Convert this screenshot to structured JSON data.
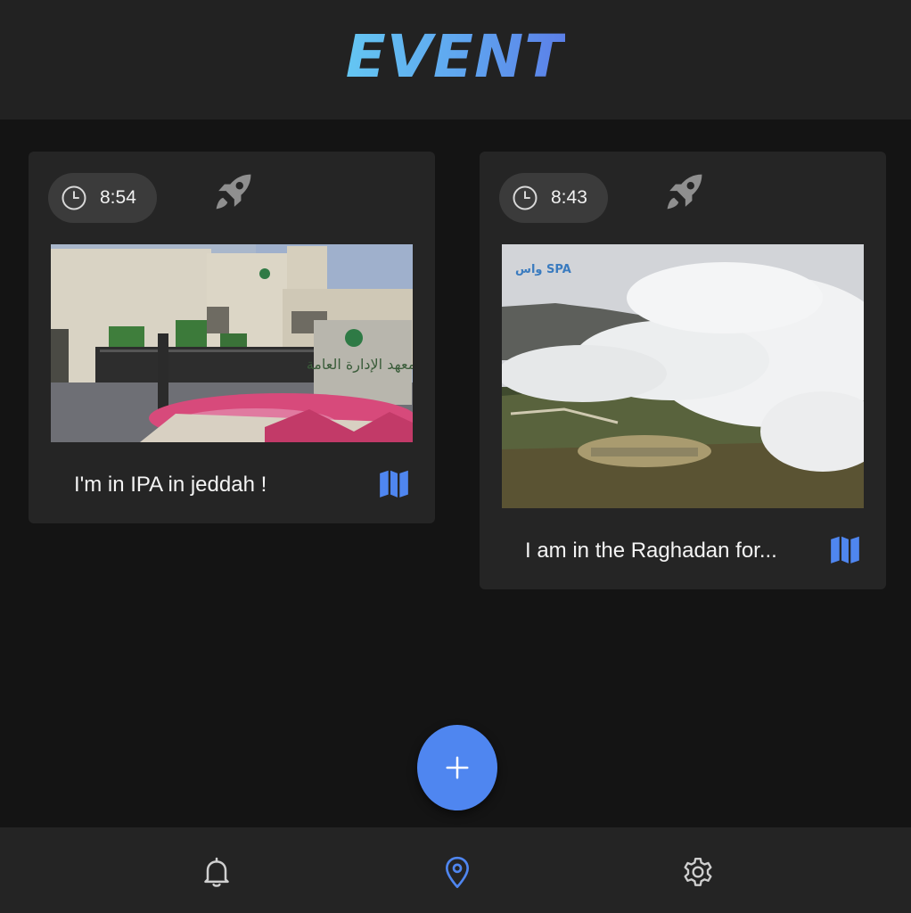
{
  "app": {
    "title": "EVENT"
  },
  "events": [
    {
      "time": "8:54",
      "caption": "I'm in IPA in jeddah !",
      "photo_icon": "building-photo",
      "photo_sign": "معهد الإدارة العامة"
    },
    {
      "time": "8:43",
      "caption": "I am in the Raghadan for...",
      "photo_icon": "mountain-fog-photo",
      "photo_watermark": "واس SPA"
    }
  ],
  "icons": {
    "clock": "clock-icon",
    "rocket": "rocket-icon",
    "map": "map-icon",
    "add": "plus-icon",
    "bell": "bell-icon",
    "location": "location-pin-icon",
    "settings": "gear-icon"
  },
  "colors": {
    "background": "#141414",
    "surface": "#252525",
    "accent": "#4f86f0",
    "nav_active": "#4f86f0",
    "nav_inactive": "#cfcfcf"
  },
  "bottom_nav": {
    "active": "location"
  }
}
